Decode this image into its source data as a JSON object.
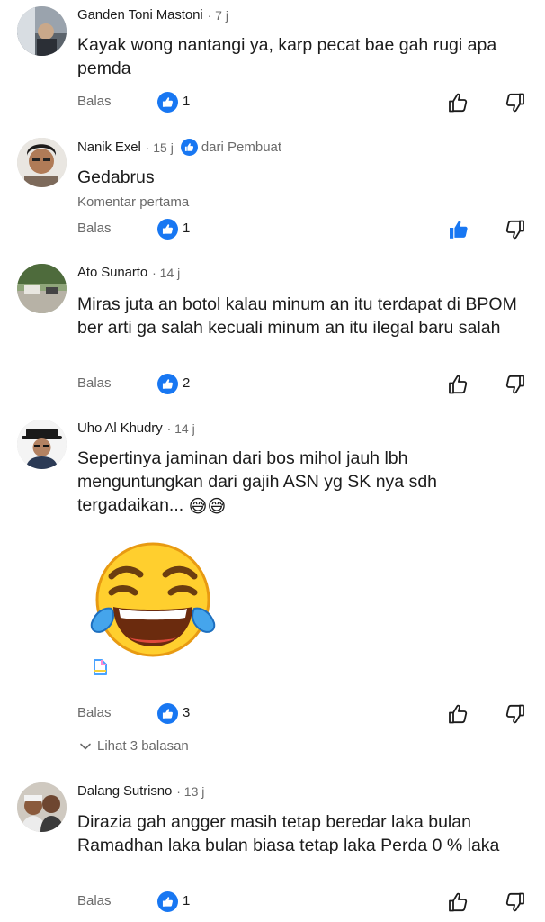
{
  "comments": [
    {
      "author": "Ganden Toni Mastoni",
      "time": "· 7 j",
      "text": "Kayak wong nantangi ya, karp pecat bae gah rugi apa pemda",
      "reply_label": "Balas",
      "like_count": "1",
      "liked": false
    },
    {
      "author": "Nanik Exel",
      "time": "· 15 j",
      "creator_label": "dari Pembuat",
      "text": "Gedabrus",
      "note": "Komentar pertama",
      "reply_label": "Balas",
      "like_count": "1",
      "liked": true
    },
    {
      "author": "Ato Sunarto",
      "time": "· 14 j",
      "text": "Miras juta an botol kalau minum an itu terdapat di BPOM ber arti ga salah kecuali minum an itu ilegal baru salah",
      "reply_label": "Balas",
      "like_count": "2",
      "liked": false
    },
    {
      "author": "Uho Al Khudry",
      "time": "· 14 j",
      "text": "Sepertinya jaminan dari bos mihol jauh lbh menguntungkan dari gajih ASN yg SK nya sdh tergadaikan...",
      "emojis": "😅😅",
      "reply_label": "Balas",
      "like_count": "3",
      "liked": false,
      "replies_label": "Lihat 3 balasan"
    },
    {
      "author": "Dalang Sutrisno",
      "time": "· 13 j",
      "text": "Dirazia gah angger masih tetap beredar laka bulan Ramadhan laka bulan biasa tetap laka Perda 0 % laka",
      "reply_label": "Balas",
      "like_count": "1",
      "liked": false
    }
  ],
  "colors": {
    "accent": "#1877f2",
    "text": "#1c1c1c",
    "secondary": "#6b6b6b"
  },
  "icons": {
    "like_badge": "like-badge-icon",
    "thumb_up": "thumb-up-icon",
    "thumb_down": "thumb-down-icon",
    "chevron": "chevron-down-icon",
    "sticker": "laughing-tears-sticker"
  }
}
